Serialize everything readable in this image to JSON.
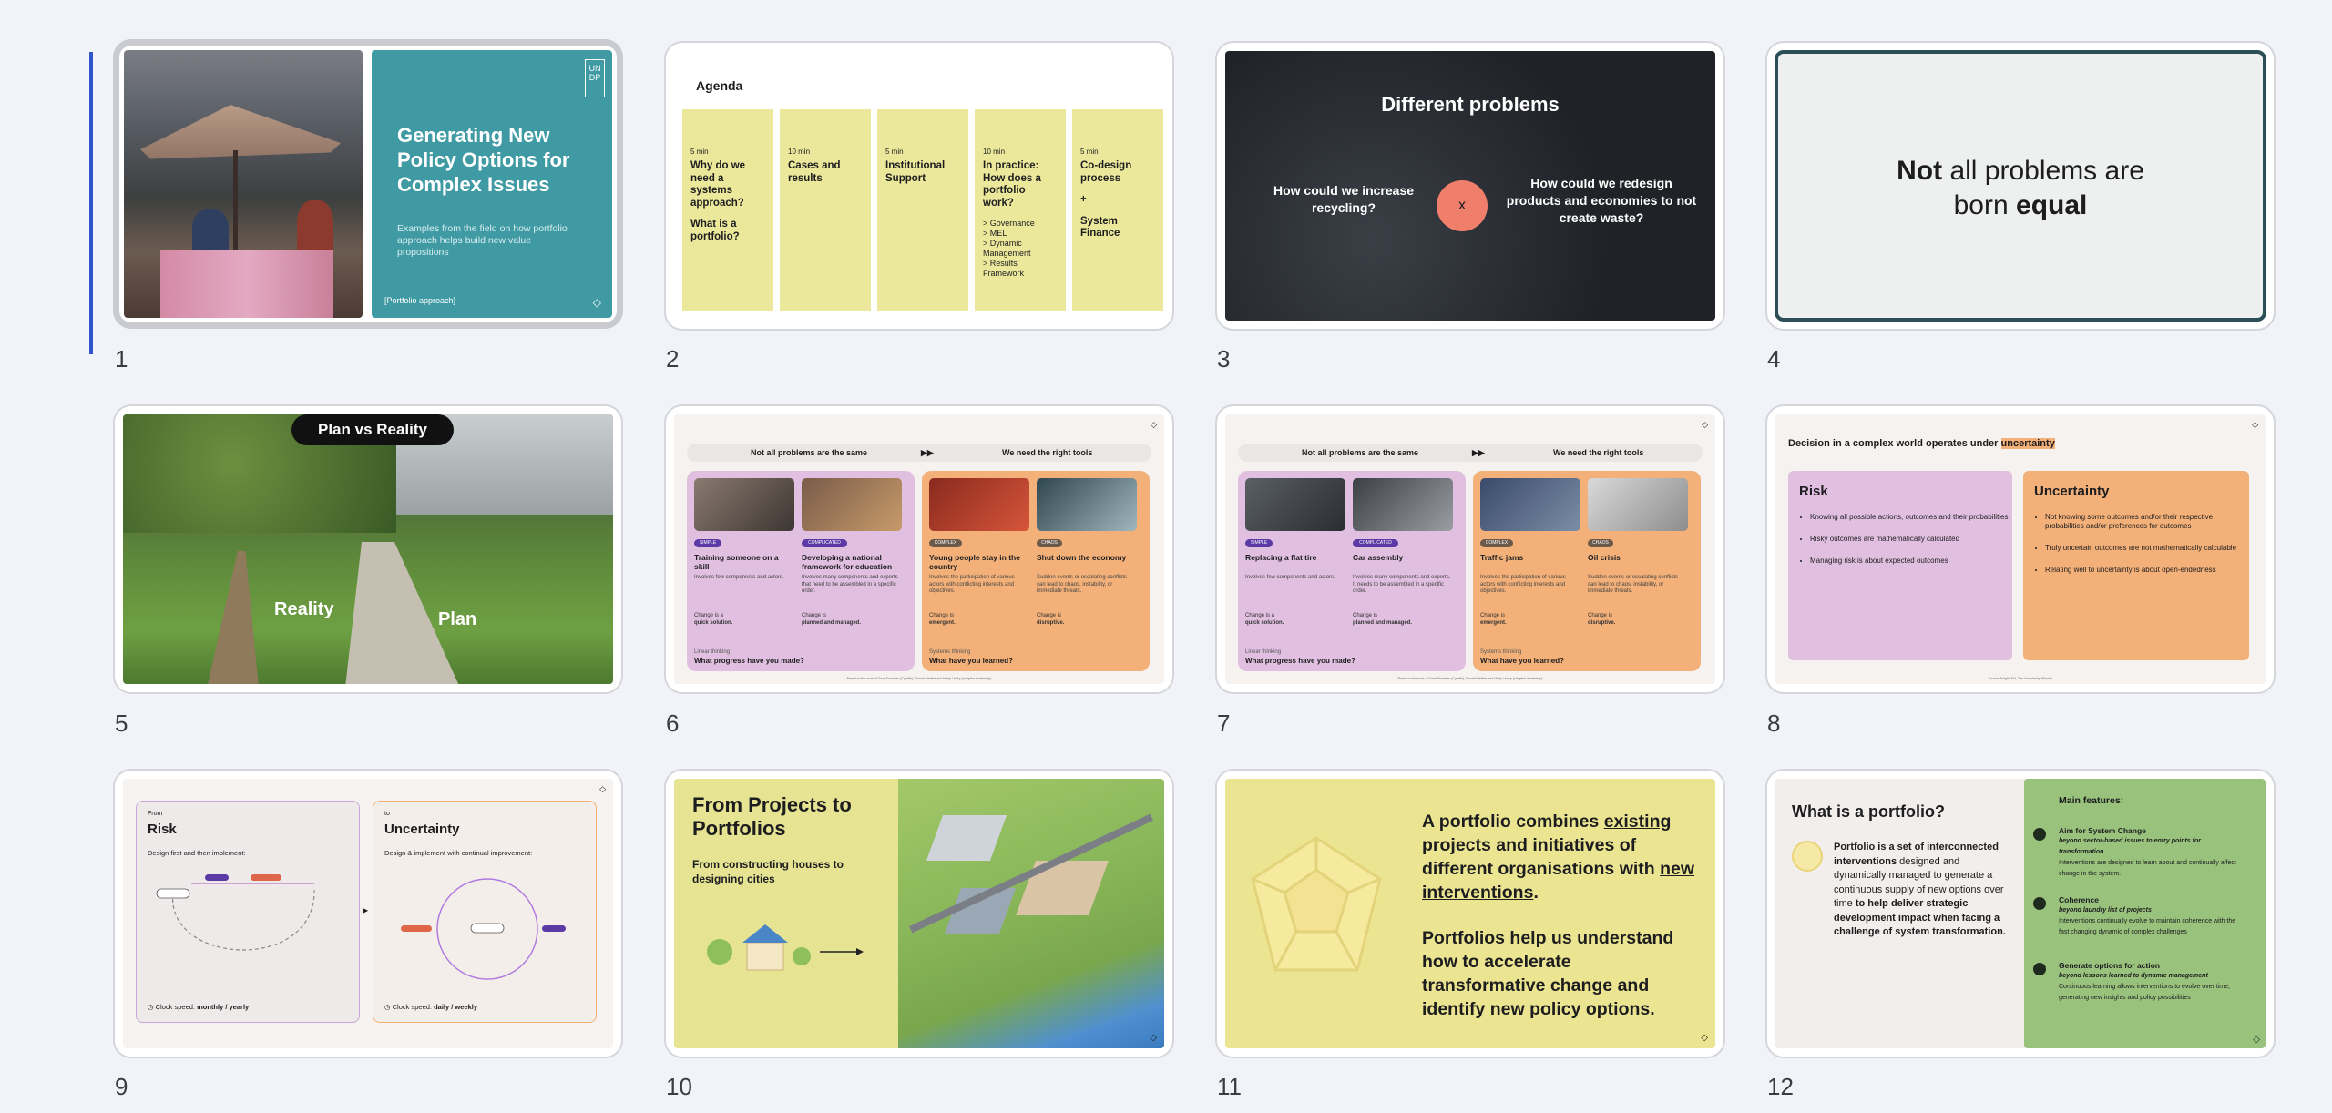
{
  "slides": [
    {
      "number": "1",
      "title": "Generating New Policy Options for Complex Issues",
      "subtitle": "Examples from the field on how portfolio approach helps build new value propositions",
      "tag": "[Portfolio approach]",
      "logo": "UN DP",
      "accent": "#3f9aa4"
    },
    {
      "number": "2",
      "title": "Agenda",
      "columns": [
        {
          "time": "5 min",
          "heading": "Why do we need a systems approach?",
          "heading2": "What is a portfolio?"
        },
        {
          "time": "10 min",
          "heading": "Cases and results"
        },
        {
          "time": "5 min",
          "heading": "Institutional Support"
        },
        {
          "time": "10 min",
          "heading": "In practice: How does a portfolio work?",
          "sub": "> Governance\n> MEL\n> Dynamic Management\n> Results Framework"
        },
        {
          "time": "5 min",
          "heading": "Co-design process",
          "plus": "+",
          "heading2": "System Finance"
        }
      ],
      "accent": "#ece89b"
    },
    {
      "number": "3",
      "title": "Different problems",
      "left": "How could we increase recycling?",
      "right": "How could we redesign products and economies to not create waste?",
      "mark": "x",
      "mark_color": "#ef7f6a"
    },
    {
      "number": "4",
      "text_bold1": "Not",
      "text1": " all problems are",
      "text2": "born ",
      "text_bold2": "equal",
      "border": "#2a4f57"
    },
    {
      "number": "5",
      "title": "Plan vs Reality",
      "reality": "Reality",
      "plan": "Plan"
    },
    {
      "number": "6",
      "left_head": "Not all problems are the same",
      "right_head": "We need the right tools",
      "arrow": "▶▶",
      "cards": [
        {
          "tag": "SIMPLE",
          "title": "Training someone on a skill",
          "text": "Involves few components and actors.",
          "change_label": "Change is a",
          "change": "quick solution."
        },
        {
          "tag": "COMPLICATED",
          "title": "Developing a national framework for education",
          "text": "Involves many components and experts that need to be assembled in a specific order.",
          "change_label": "Change is",
          "change": "planned and managed."
        },
        {
          "tag": "COMPLEX",
          "title": "Young people stay in the country",
          "text": "Involves the participation of various actors with conflicting interests and objectives.",
          "change_label": "Change is",
          "change": "emergent."
        },
        {
          "tag": "CHAOS",
          "title": "Shut down the economy",
          "text": "Sudden events or escalating conflicts can lead to chaos, instability, or immediate threats.",
          "change_label": "Change is",
          "change": "disruptive."
        }
      ],
      "left_foot_label": "Linear thinking",
      "left_foot": "What progress have you made?",
      "right_foot_label": "Systems thinking",
      "right_foot": "What have you learned?",
      "footnote": "Based on the work of Dave Snowden (Cynefin), Ronald Heifetz and Marty Linsky (adaptive leadership)"
    },
    {
      "number": "7",
      "left_head": "Not all problems are the same",
      "right_head": "We need the right tools",
      "arrow": "▶▶",
      "cards": [
        {
          "tag": "SIMPLE",
          "title": "Replacing a flat tire",
          "text": "Involves few components and actors.",
          "change_label": "Change is a",
          "change": "quick solution."
        },
        {
          "tag": "COMPLICATED",
          "title": "Car assembly",
          "text": "Involves many components and experts. It needs to be assembled in a specific order.",
          "change_label": "Change is",
          "change": "planned and managed."
        },
        {
          "tag": "COMPLEX",
          "title": "Traffic jams",
          "text": "Involves the participation of various actors with conflicting interests and objectives.",
          "change_label": "Change is",
          "change": "emergent."
        },
        {
          "tag": "CHAOS",
          "title": "Oil crisis",
          "text": "Sudden events or escalating conflicts can lead to chaos, instability, or immediate threats.",
          "change_label": "Change is",
          "change": "disruptive."
        }
      ],
      "left_foot_label": "Linear thinking",
      "left_foot": "What progress have you made?",
      "right_foot_label": "Systems thinking",
      "right_foot": "What have you learned?",
      "footnote": "Based on the work of Dave Snowden (Cynefin), Ronald Heifetz and Marty Linsky (adaptive leadership)"
    },
    {
      "number": "8",
      "title_pre": "Decision in a complex world operates under ",
      "title_hl": "uncertainty",
      "risk_title": "Risk",
      "risk_items": [
        "Knowing all possible actions, outcomes and their probabilities",
        "Risky outcomes are mathematically calculated",
        "Managing risk is about expected outcomes"
      ],
      "unc_title": "Uncertainty",
      "unc_items": [
        "Not knowing some outcomes and/or their respective probabilities and/or preferences for outcomes",
        "Truly uncertain outcomes are not mathematically calculable",
        "Relating well to uncertainty is about open-endedness"
      ],
      "footnote": "Source: Knight, F.H. The Uncertainty Window"
    },
    {
      "number": "9",
      "from": "From",
      "risk": "Risk",
      "risk_sub": "Design first and then implement:",
      "to": "to",
      "unc": "Uncertainty",
      "unc_sub": "Design & implement with continual improvement:",
      "risk_speed_label": "Clock speed: ",
      "risk_speed": "monthly / yearly",
      "unc_speed_label": "Clock speed: ",
      "unc_speed": "daily / weekly"
    },
    {
      "number": "10",
      "title": "From Projects to Portfolios",
      "subtitle": "From constructing houses to designing cities",
      "bg": "#e6e493"
    },
    {
      "number": "11",
      "l1_a": "A portfolio combines ",
      "l1_u": "existing",
      "l2": "projects and initiatives of different organisations with",
      "l3_u": "new interventions",
      "l3_b": ".",
      "p2": "Portfolios help us understand how to accelerate transformative change and identify new policy options."
    },
    {
      "number": "12",
      "title": "What is a portfolio?",
      "def_bold": "Portfolio is a set of interconnected interventions",
      "def_mid": " designed and dynamically managed to generate a continuous supply of new options over time ",
      "def_bold2": "to help deliver strategic development impact when facing a challenge of system transformation.",
      "features_title": "Main features:",
      "features": [
        {
          "title": "Aim for System Change",
          "italic": "beyond sector-based issues to entry points for transformation",
          "text": "Interventions are designed to learn about and continually affect change in the system."
        },
        {
          "title": "Coherence",
          "italic": "beyond laundry list of projects",
          "text": "Interventions continually evolve to maintain coherence with the fast changing dynamic of complex challenges"
        },
        {
          "title": "Generate options for action",
          "italic": "beyond lessons learned to dynamic management",
          "text": "Continuous learning allows interventions to evolve over time, generating new insights and policy possibilities"
        }
      ]
    }
  ]
}
